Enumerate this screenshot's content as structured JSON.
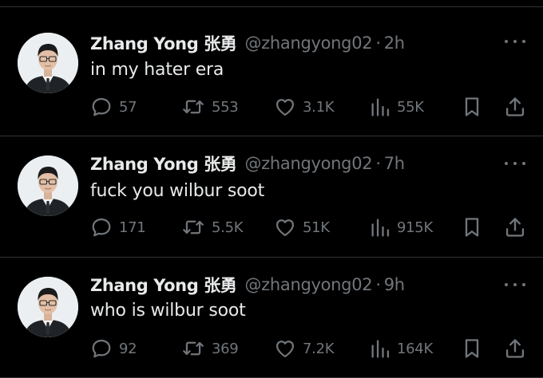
{
  "tweets": [
    {
      "author": {
        "name": "Zhang Yong 张勇",
        "handle": "@zhangyong02"
      },
      "separator": "·",
      "time": "2h",
      "text": "in my hater era",
      "stats": {
        "replies": "57",
        "retweets": "553",
        "likes": "3.1K",
        "views": "55K"
      }
    },
    {
      "author": {
        "name": "Zhang Yong 张勇",
        "handle": "@zhangyong02"
      },
      "separator": "·",
      "time": "7h",
      "text": "fuck you wilbur soot",
      "stats": {
        "replies": "171",
        "retweets": "5.5K",
        "likes": "51K",
        "views": "915K"
      }
    },
    {
      "author": {
        "name": "Zhang Yong 张勇",
        "handle": "@zhangyong02"
      },
      "separator": "·",
      "time": "9h",
      "text": "who is wilbur soot",
      "stats": {
        "replies": "92",
        "retweets": "369",
        "likes": "7.2K",
        "views": "164K"
      }
    }
  ],
  "icons": {
    "reply": "speech-bubble-icon",
    "retweet": "retweet-arrows-icon",
    "like": "heart-icon",
    "views": "bar-chart-icon",
    "bookmark": "bookmark-icon",
    "share": "share-upload-icon",
    "more": "more-dots-icon"
  },
  "colors": {
    "background": "#000000",
    "primary_text": "#e7e9ea",
    "secondary_text": "#71767b",
    "divider": "#2f3336"
  }
}
